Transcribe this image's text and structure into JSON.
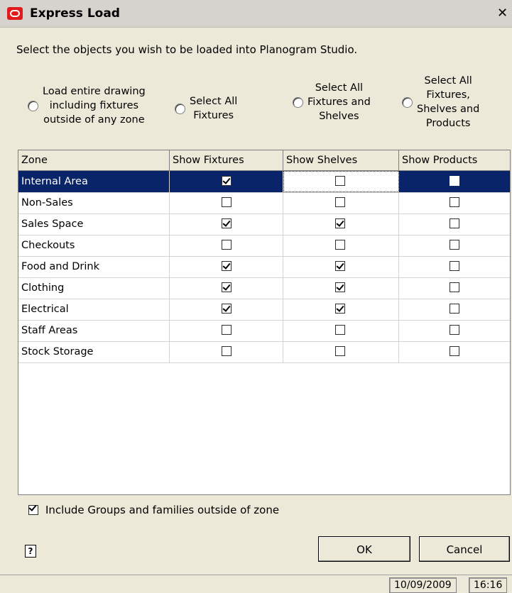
{
  "window": {
    "title": "Express Load"
  },
  "instruction": "Select the objects you wish to be loaded into Planogram Studio.",
  "options": [
    {
      "label": "Load entire drawing\nincluding fixtures\noutside of any zone"
    },
    {
      "label": "Select All\nFixtures"
    },
    {
      "label": "Select All\nFixtures and\nShelves"
    },
    {
      "label": "Select All\nFixtures,\nShelves and\nProducts"
    }
  ],
  "table": {
    "headers": [
      "Zone",
      "Show Fixtures",
      "Show Shelves",
      "Show Products"
    ],
    "rows": [
      {
        "zone": "Internal Area",
        "fixtures": true,
        "shelves": false,
        "products": false,
        "selected": true
      },
      {
        "zone": "Non-Sales",
        "fixtures": false,
        "shelves": false,
        "products": false
      },
      {
        "zone": "Sales Space",
        "fixtures": true,
        "shelves": true,
        "products": false
      },
      {
        "zone": "Checkouts",
        "fixtures": false,
        "shelves": false,
        "products": false
      },
      {
        "zone": "Food and Drink",
        "fixtures": true,
        "shelves": true,
        "products": false
      },
      {
        "zone": "Clothing",
        "fixtures": true,
        "shelves": true,
        "products": false
      },
      {
        "zone": "Electrical",
        "fixtures": true,
        "shelves": true,
        "products": false
      },
      {
        "zone": "Staff Areas",
        "fixtures": false,
        "shelves": false,
        "products": false
      },
      {
        "zone": "Stock Storage",
        "fixtures": false,
        "shelves": false,
        "products": false
      }
    ]
  },
  "include_groups": {
    "label": "Include Groups and families outside of zone",
    "checked": true
  },
  "buttons": {
    "ok": "OK",
    "cancel": "Cancel"
  },
  "status": {
    "date": "10/09/2009",
    "time": "16:16"
  }
}
